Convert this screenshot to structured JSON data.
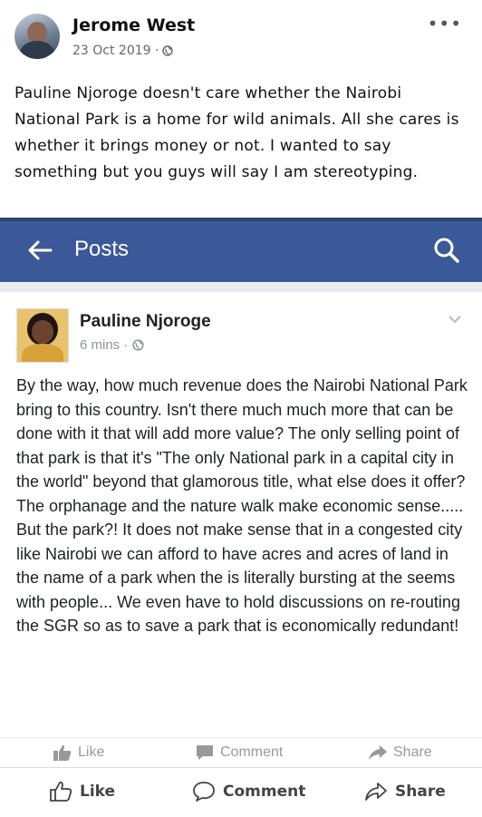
{
  "outer_post": {
    "author": "Jerome West",
    "date": "23 Oct 2019 ·",
    "privacy_icon": "globe-icon",
    "menu_icon": "more-options-icon",
    "text": "Pauline Njoroge doesn't care whether the Nairobi National Park is a home for wild animals. All she cares is whether it brings money or not. I wanted to say something but you guys will say I am stereotyping."
  },
  "embedded_screenshot": {
    "topbar": {
      "title": "Posts",
      "color": "#3b5998"
    },
    "post": {
      "author": "Pauline Njoroge",
      "time": "6 mins ·",
      "text": "By the way, how much revenue does the Nairobi National Park bring to this country. Isn't there much much more that can be done with it that will add more value? The only selling point of that park is that it's \"The only National park in a capital city in the world\" beyond that glamorous title, what else does it offer? The orphanage and the nature walk make economic sense..... But the park?! It does not make sense that in a congested city like Nairobi we can afford to have acres and acres of land in the name of a park when the is literally bursting at the seems with people... We even have to hold discussions on re-routing the SGR so as to save a park that is economically redundant!",
      "actions": {
        "like": "Like",
        "comment": "Comment",
        "share": "Share"
      }
    }
  },
  "action_bar": {
    "like": "Like",
    "comment": "Comment",
    "share": "Share"
  }
}
